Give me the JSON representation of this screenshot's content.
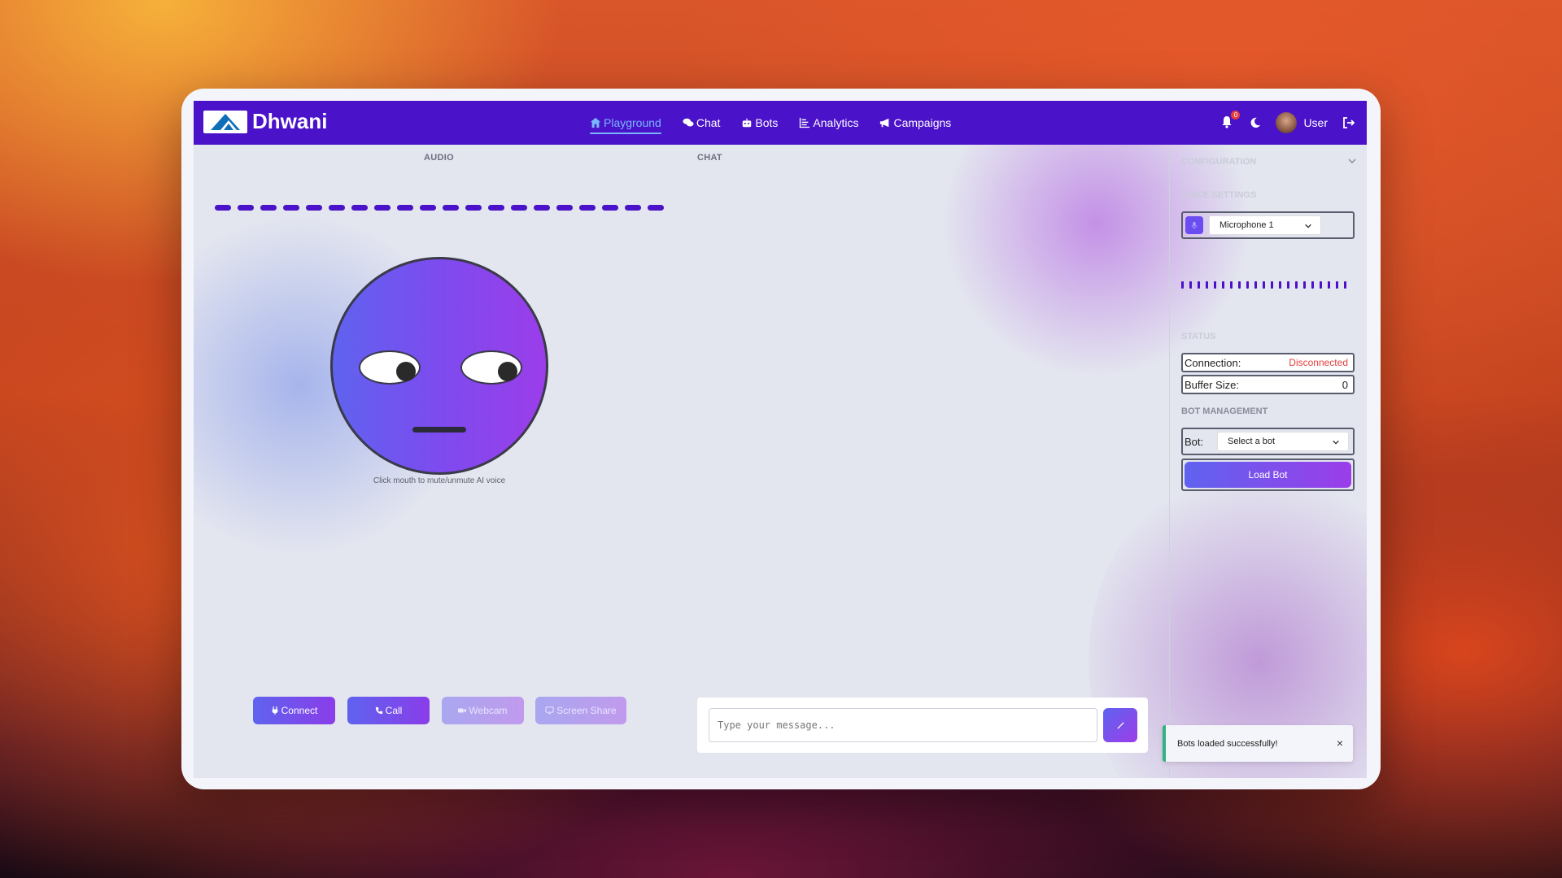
{
  "app": {
    "brand": "Dhwani",
    "nav": [
      {
        "label": "Playground",
        "icon": "home-icon",
        "active": true
      },
      {
        "label": "Chat",
        "icon": "comments-icon",
        "active": false
      },
      {
        "label": "Bots",
        "icon": "robot-icon",
        "active": false
      },
      {
        "label": "Analytics",
        "icon": "chart-icon",
        "active": false
      },
      {
        "label": "Campaigns",
        "icon": "megaphone-icon",
        "active": false
      }
    ],
    "notifications_count": "0",
    "user_name": "User"
  },
  "main": {
    "audio_label": "AUDIO",
    "chat_label": "CHAT",
    "face_caption": "Click mouth to mute/unmute AI voice",
    "buttons": {
      "connect": "Connect",
      "call": "Call",
      "webcam": "Webcam",
      "screen_share": "Screen Share"
    },
    "chat_placeholder": "Type your message..."
  },
  "sidebar": {
    "configuration_title": "CONFIGURATION",
    "voice_settings_title": "VOICE SETTINGS",
    "microphone_value": "Microphone 1",
    "status_title": "STATUS",
    "connection_label": "Connection:",
    "connection_value": "Disconnected",
    "buffer_label": "Buffer Size:",
    "buffer_value": "0",
    "bot_management_title": "BOT MANAGEMENT",
    "bot_label": "Bot:",
    "bot_select_value": "Select a bot",
    "load_bot_label": "Load Bot"
  },
  "toast": {
    "message": "Bots loaded successfully!",
    "close": "×"
  },
  "colors": {
    "brand": "#4a12c9",
    "accent_gradient_start": "#5f63ef",
    "accent_gradient_end": "#9b3de9",
    "disconnected": "#e53e3e",
    "success": "#2fb380"
  }
}
